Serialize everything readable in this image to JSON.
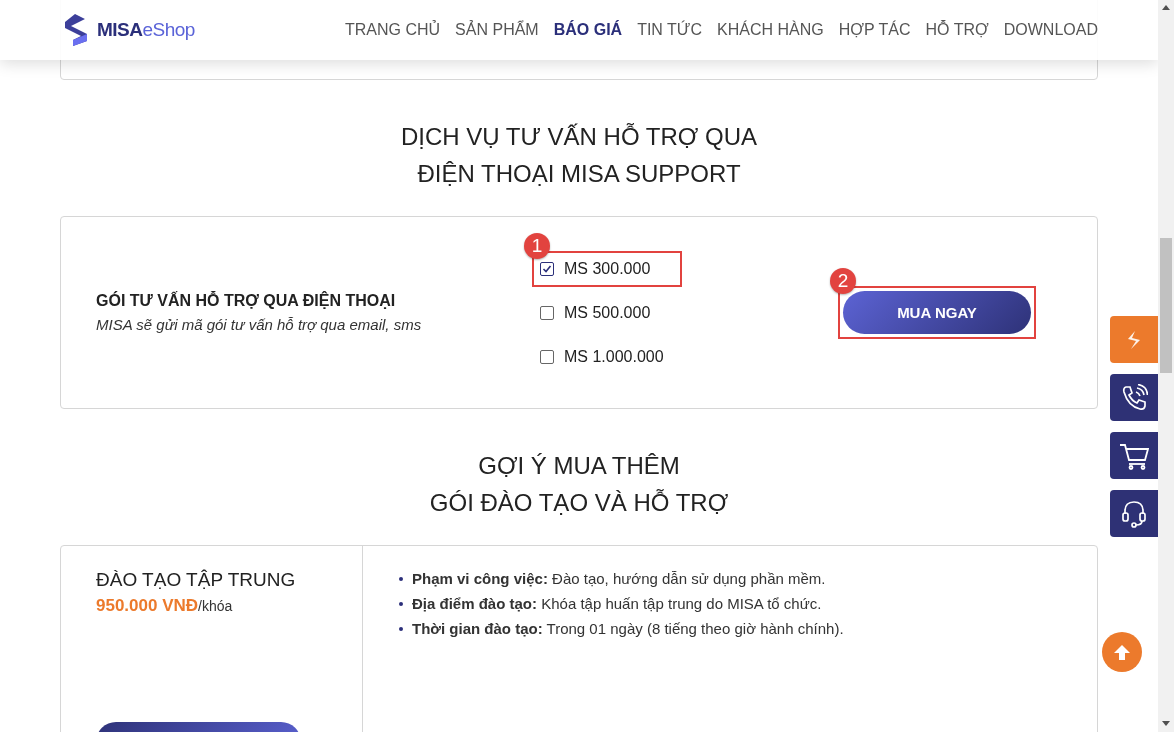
{
  "header": {
    "logo": {
      "strong": "MISA",
      "light": "eShop"
    },
    "nav": [
      {
        "label": "TRANG CHỦ",
        "selected": false
      },
      {
        "label": "SẢN PHẨM",
        "selected": false
      },
      {
        "label": "BÁO GIÁ",
        "selected": true
      },
      {
        "label": "TIN TỨC",
        "selected": false
      },
      {
        "label": "KHÁCH HÀNG",
        "selected": false
      },
      {
        "label": "HỢP TÁC",
        "selected": false
      },
      {
        "label": "HỖ TRỢ",
        "selected": false
      },
      {
        "label": "DOWNLOAD",
        "selected": false
      }
    ]
  },
  "support_section": {
    "title_lines": [
      "DỊCH VỤ TƯ VẤN HỖ TRỢ QUA",
      "ĐIỆN THOẠI MISA SUPPORT"
    ],
    "package_title": "GÓI TƯ VẤN HỖ TRỢ QUA ĐIỆN THOẠI",
    "package_note": "MISA sẽ gửi mã gói tư vấn hỗ trợ qua email, sms",
    "options": [
      {
        "label": "MS 300.000",
        "checked": true,
        "annotation": "1"
      },
      {
        "label": "MS 500.000",
        "checked": false
      },
      {
        "label": "MS 1.000.000",
        "checked": false
      }
    ],
    "buy_button": {
      "label": "MUA NGAY",
      "annotation": "2"
    }
  },
  "suggest_section": {
    "title_lines": [
      "GỢI Ý MUA THÊM",
      "GÓI ĐÀO TẠO VÀ HỖ TRỢ"
    ],
    "training": {
      "title": "ĐÀO TẠO TẬP TRUNG",
      "price": "950.000 VNĐ",
      "unit": "/khóa",
      "details": [
        "**Phạm vi công việc:** Đào tạo, hướng dẫn sử dụng phần mềm.",
        "**Địa điểm đào tạo:** Khóa tập huấn tập trung do MISA tổ chức.",
        "**Thời gian đào tạo:** Trong 01 ngày (8 tiếng theo giờ hành chính)."
      ]
    }
  }
}
